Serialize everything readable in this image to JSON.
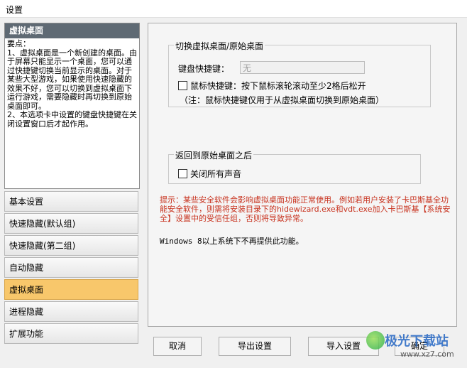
{
  "window": {
    "title": "设置"
  },
  "help": {
    "heading": "虚拟桌面",
    "text": "要点：\n1、虚拟桌面是一个新创建的桌面。由于屏幕只能显示一个桌面，您可以通过快捷键切换当前显示的桌面。对于某些大型游戏，如果使用快速隐藏的效果不好，您可以切换到虚拟桌面下运行游戏，需要隐藏时再切换到原始桌面即可。\n2、本选项卡中设置的键盘快捷键在关闭设置窗口后才起作用。"
  },
  "nav": {
    "items": [
      {
        "label": "基本设置"
      },
      {
        "label": "快速隐藏(默认组)"
      },
      {
        "label": "快速隐藏(第二组)"
      },
      {
        "label": "自动隐藏"
      },
      {
        "label": "虚拟桌面"
      },
      {
        "label": "进程隐藏"
      },
      {
        "label": "扩展功能"
      }
    ],
    "active_index": 4
  },
  "switch_group": {
    "title": "切换虚拟桌面/原始桌面",
    "keyboard_label": "键盘快捷键：",
    "keyboard_value": "无",
    "mouse_checkbox_label": "鼠标快捷键：按下鼠标滚轮滚动至少2格后松开",
    "mouse_checked": false,
    "note": "（注：鼠标快捷键仅用于从虚拟桌面切换到原始桌面）"
  },
  "return_group": {
    "title": "返回到原始桌面之后",
    "mute_checkbox_label": "关闭所有声音",
    "mute_checked": false
  },
  "warning_text": "提示：某些安全软件会影响虚拟桌面功能正常使用。例如若用户安装了卡巴斯基全功能安全软件，则需将安装目录下的hidewizard.exe和vdt.exe加入卡巴斯基【系统安全】设置中的受信任组，否则将导致异常。",
  "windows8_note": "Windows 8以上系统下不再提供此功能。",
  "buttons": {
    "cancel": "取消",
    "export": "导出设置",
    "import": "导入设置",
    "ok": "确定"
  },
  "watermark": {
    "text": "极光下载站",
    "url": "www.xz7.com"
  },
  "colors": {
    "active_tab": "#f8c76b",
    "warning": "#c8321e",
    "help_header": "#5f6a74"
  }
}
